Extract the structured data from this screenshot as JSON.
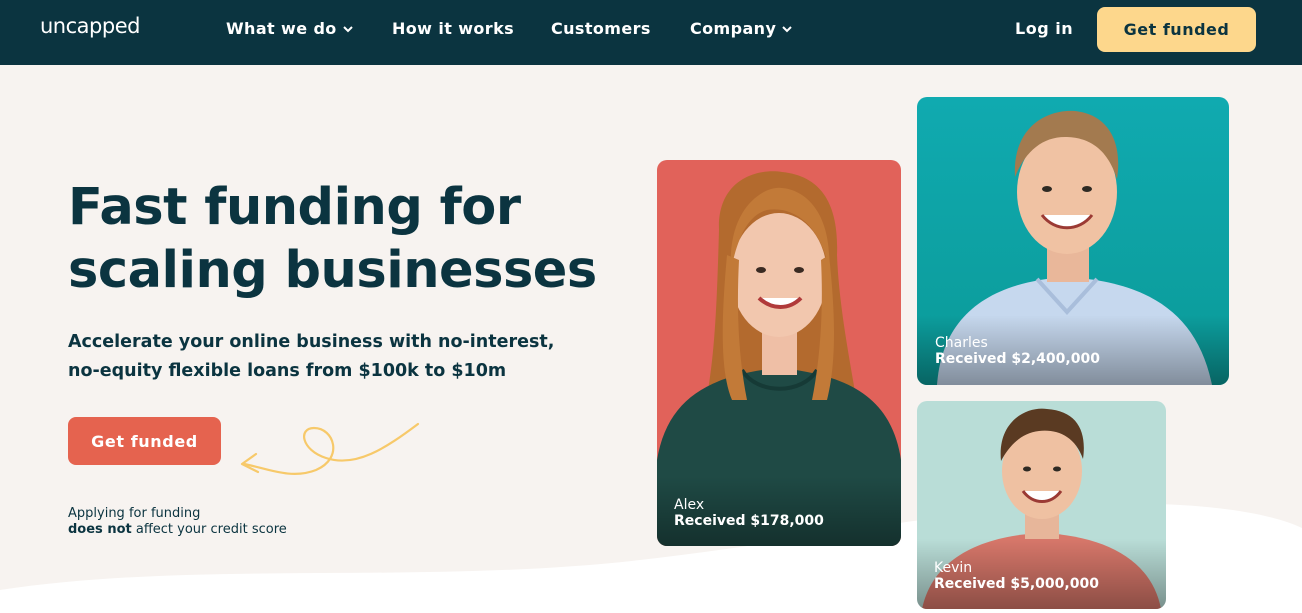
{
  "nav": {
    "logo": "uncapped",
    "items": [
      {
        "label": "What we do",
        "dropdown": true
      },
      {
        "label": "How it works",
        "dropdown": false
      },
      {
        "label": "Customers",
        "dropdown": false
      },
      {
        "label": "Company",
        "dropdown": true
      }
    ],
    "login": "Log in",
    "cta": "Get funded"
  },
  "hero": {
    "title_line1": "Fast funding for",
    "title_bold": "scaling",
    "title_rest": "businesses",
    "subtitle": "Accelerate your online business with no-interest, no-equity flexible loans from $100k to $10m",
    "cta": "Get funded",
    "note_line1": "Applying for funding",
    "note_bold": "does not",
    "note_rest": "affect your credit score"
  },
  "testimonials": [
    {
      "name": "Alex",
      "amount": "Received $178,000"
    },
    {
      "name": "Charles",
      "amount": "Received $2,400,000"
    },
    {
      "name": "Kevin",
      "amount": "Received $5,000,000"
    }
  ],
  "colors": {
    "nav_bg": "#0b3440",
    "page_bg": "#f7f3f0",
    "accent_yellow": "#fdd78c",
    "accent_coral": "#e5634f",
    "card_alex": "#e1625a",
    "card_charles": "#10aab0",
    "card_kevin": "#b9ddd7"
  },
  "icons": [
    "chevron-down-icon",
    "arrow-squiggle-icon"
  ]
}
